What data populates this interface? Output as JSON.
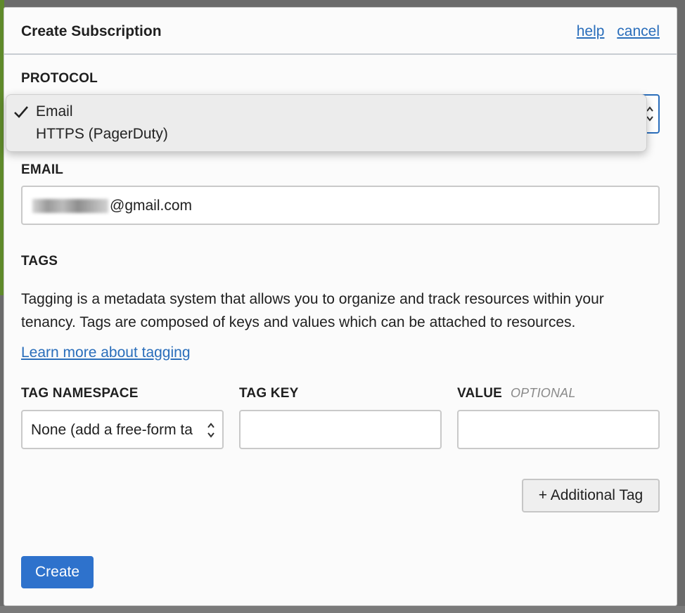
{
  "modal": {
    "title": "Create Subscription",
    "help_link": "help",
    "cancel_link": "cancel"
  },
  "protocol": {
    "label": "PROTOCOL",
    "options": [
      "Email",
      "HTTPS (PagerDuty)"
    ],
    "selected": "Email"
  },
  "email": {
    "label": "EMAIL",
    "value": "@gmail.com"
  },
  "tags": {
    "label": "TAGS",
    "description": "Tagging is a metadata system that allows you to organize and track resources within your tenancy. Tags are composed of keys and values which can be attached to resources.",
    "learn_more": "Learn more about tagging",
    "namespace_label": "TAG NAMESPACE",
    "namespace_value": "None (add a free-form ta",
    "key_label": "TAG KEY",
    "key_value": "",
    "value_label": "VALUE",
    "value_optional": "OPTIONAL",
    "value_value": "",
    "additional_tag_button": "+ Additional Tag"
  },
  "actions": {
    "create_button": "Create"
  },
  "colors": {
    "link": "#2a6ebb",
    "primary_button": "#2e72cc",
    "focus_border": "#2a6ebb"
  },
  "icons": {
    "check": "checkmark-icon",
    "select_arrows": "chevron-up-down-icon"
  }
}
